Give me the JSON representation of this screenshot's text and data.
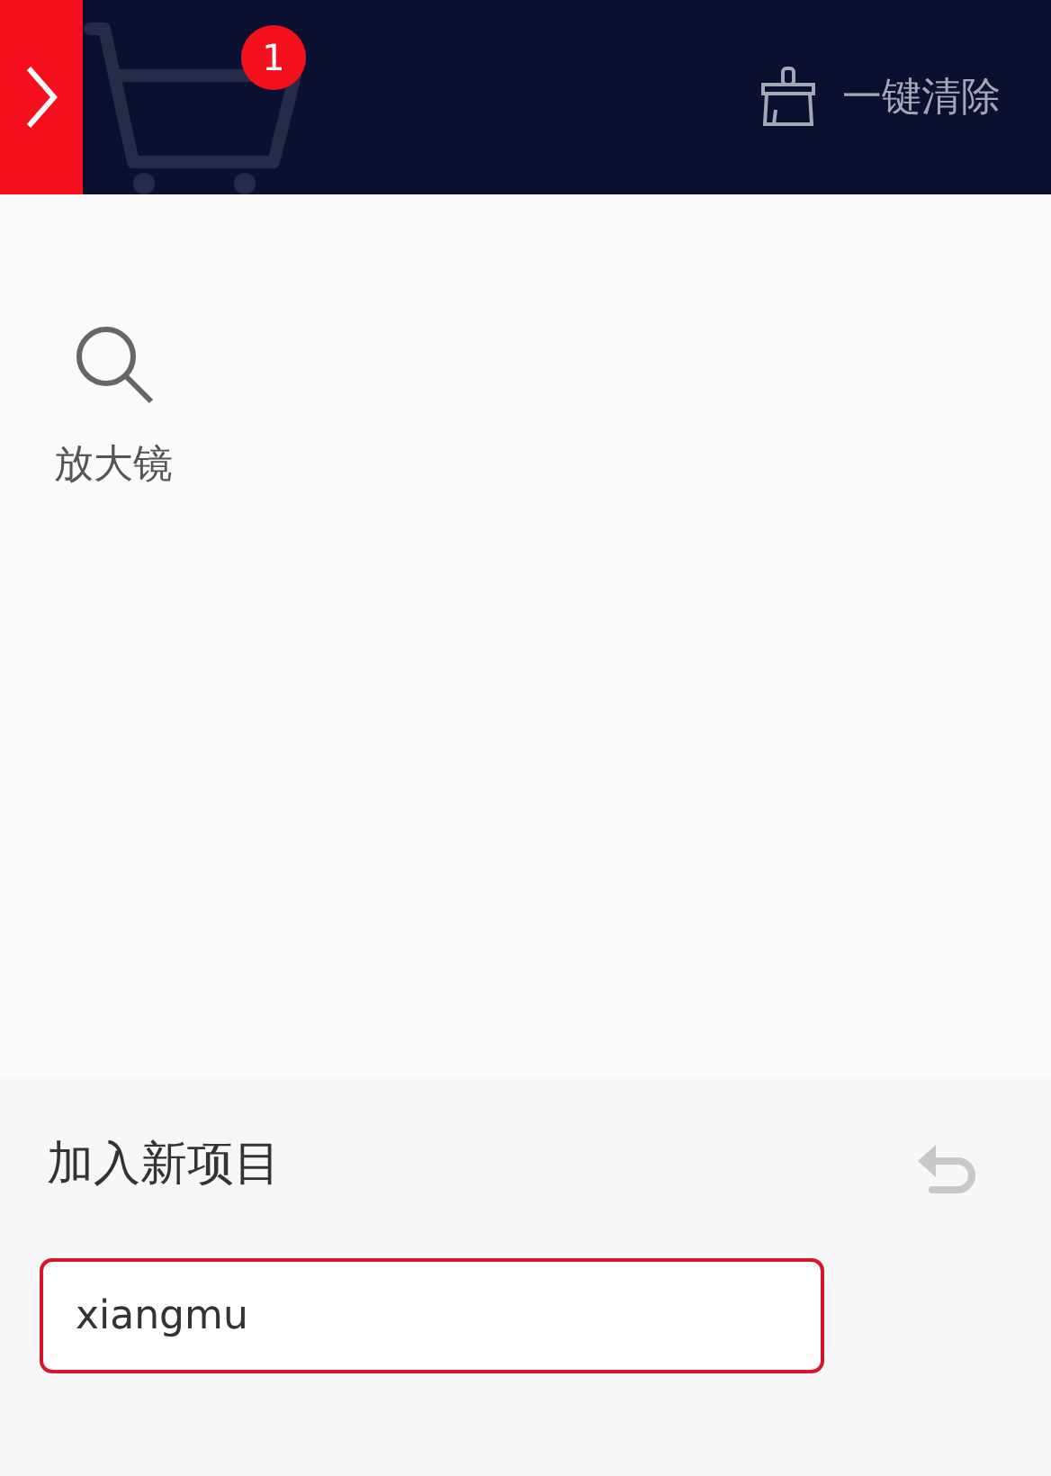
{
  "header": {
    "cart_badge": "1",
    "clear_button": "一键清除"
  },
  "items": [
    {
      "label": "放大镜"
    }
  ],
  "add_panel": {
    "title": "加入新项目",
    "input": {
      "value": "xiangmu",
      "focused": true
    }
  }
}
